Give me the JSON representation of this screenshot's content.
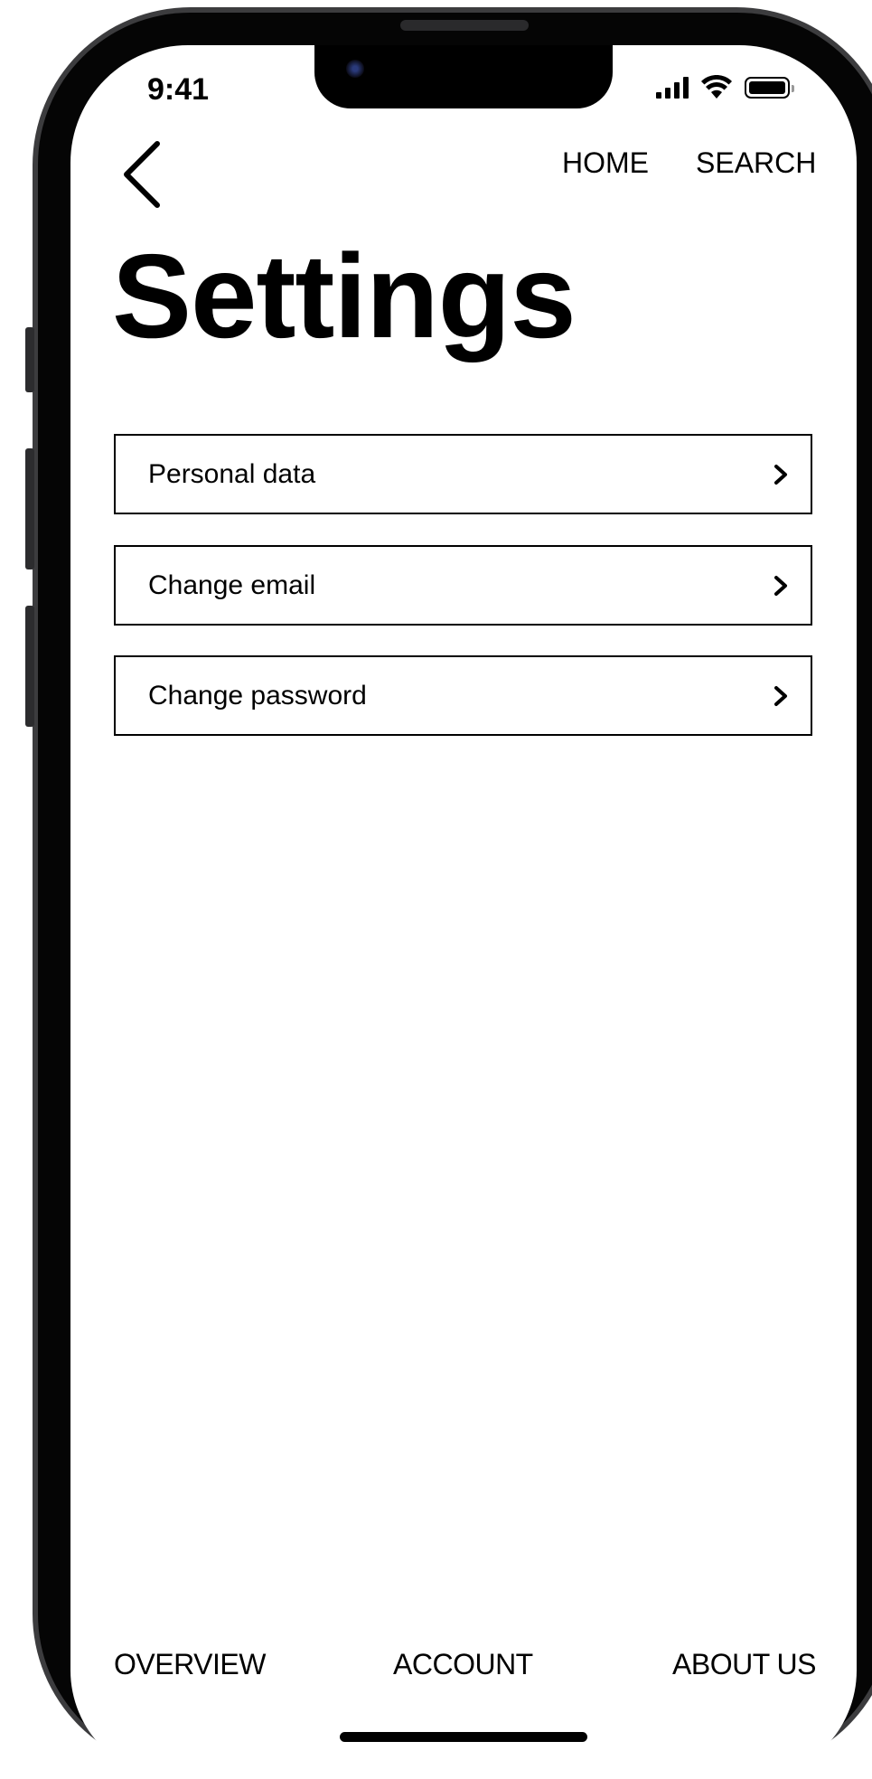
{
  "status_bar": {
    "time": "9:41",
    "icons": [
      "signal-icon",
      "wifi-icon",
      "battery-icon"
    ]
  },
  "header": {
    "back_icon": "chevron-left-icon",
    "nav": [
      "HOME",
      "SEARCH"
    ]
  },
  "page": {
    "title": "Settings"
  },
  "menu": [
    {
      "label": "Personal data",
      "icon": "chevron-right-icon"
    },
    {
      "label": "Change email",
      "icon": "chevron-right-icon"
    },
    {
      "label": "Change password",
      "icon": "chevron-right-icon"
    }
  ],
  "bottom_nav": [
    "OVERVIEW",
    "ACCOUNT",
    "ABOUT US"
  ],
  "colors": {
    "background": "#ffffff",
    "text": "#000000",
    "frame": "#050505"
  }
}
